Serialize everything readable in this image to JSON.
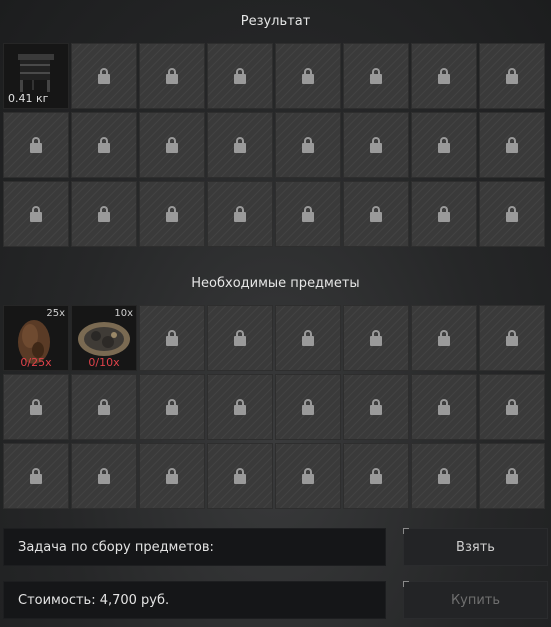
{
  "result": {
    "title": "Результат",
    "item": {
      "name": "rack-item",
      "weight": "0.41 кг"
    }
  },
  "required": {
    "title": "Необходимые предметы",
    "items": [
      {
        "name": "bag-item",
        "count": "25x",
        "progress": "0/25x"
      },
      {
        "name": "ore-item",
        "count": "10x",
        "progress": "0/10x"
      }
    ]
  },
  "task_label": "Задача по сбору предметов:",
  "cost_label": "Стоимость: 4,700 руб.",
  "buttons": {
    "take": "Взять",
    "buy": "Купить"
  },
  "colors": {
    "missing_progress": "#e0424a",
    "locked_icon": "#9a9a9a"
  }
}
